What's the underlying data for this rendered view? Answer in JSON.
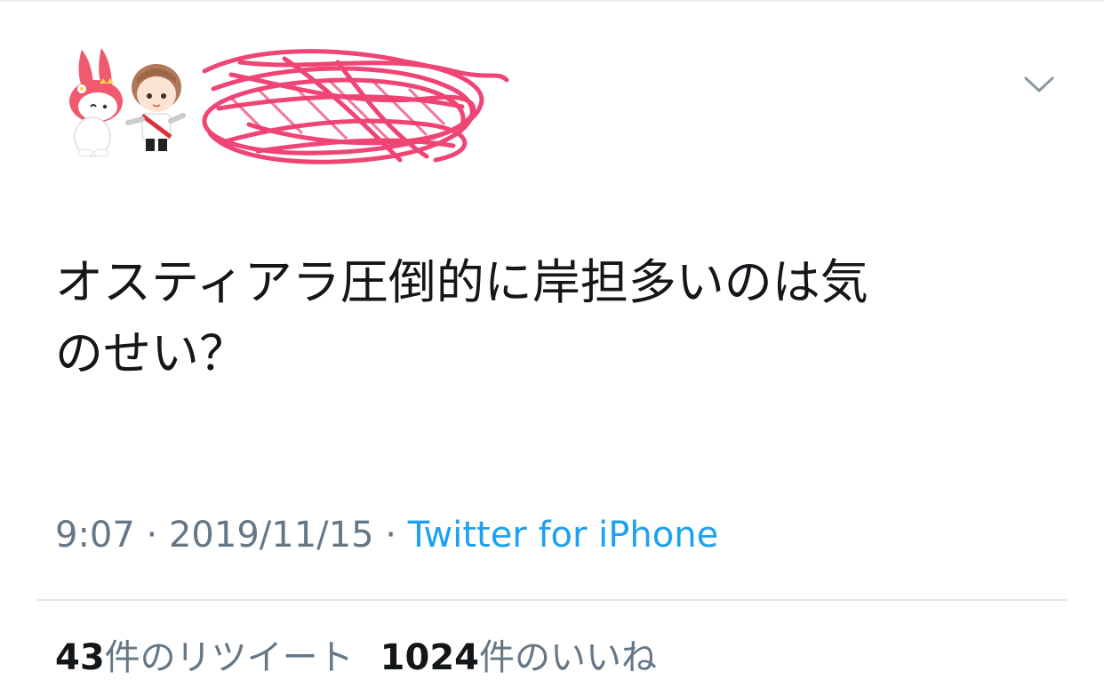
{
  "tweet": {
    "text_line1": "オスティアラ圧倒的に岸担多いのは気",
    "text_line2": "のせい？",
    "time": "9:07",
    "separator": " · ",
    "date": "2019/11/15",
    "source": "Twitter for iPhone"
  },
  "stats": {
    "retweets_count": "43",
    "retweets_label": "件のリツイート",
    "likes_count": "1024",
    "likes_label": "件のいいね"
  },
  "icons": {
    "more": "chevron-down-icon",
    "avatar": "avatar",
    "redaction": "scribble-redaction"
  },
  "colors": {
    "text": "#14171a",
    "secondary": "#657786",
    "link": "#1da1f2",
    "scribble": "#ee3c6e",
    "divider": "#e1e8ed"
  }
}
